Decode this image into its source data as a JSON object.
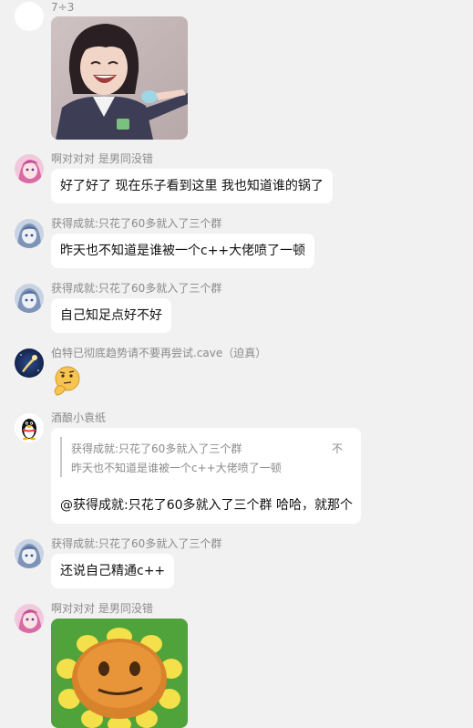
{
  "messages": [
    {
      "sender": "7÷3",
      "type": "image",
      "avatar": "white-circle-avatar",
      "image": "laughing-girl-pointing-photo"
    },
    {
      "sender": "啊对对对 是男同没错",
      "type": "text",
      "avatar": "pink-anime-girl-avatar",
      "text": "好了好了 现在乐子看到这里 我也知道谁的锅了"
    },
    {
      "sender": "获得成就:只花了60多就入了三个群",
      "type": "text",
      "avatar": "blue-anime-avatar",
      "text": "昨天也不知道是谁被一个c++大佬喷了一顿"
    },
    {
      "sender": "获得成就:只花了60多就入了三个群",
      "type": "text",
      "avatar": "blue-anime-avatar",
      "text": "自己知足点好不好"
    },
    {
      "sender": "伯特已彻底趋势请不要再尝试.cave（迫真）",
      "type": "sticker",
      "avatar": "comet-night-sky-avatar",
      "sticker": "thinking-emoji-sticker"
    },
    {
      "sender": "酒酿小袁纸",
      "type": "reply",
      "avatar": "qq-penguin-avatar",
      "quote": {
        "sender": "获得成就:只花了60多就入了三个群",
        "text": "昨天也不知道是谁被一个c++大佬喷了一顿",
        "tail": "不"
      },
      "text": "@获得成就:只花了60多就入了三个群  哈哈，就那个"
    },
    {
      "sender": "获得成就:只花了60多就入了三个群",
      "type": "text",
      "avatar": "blue-anime-avatar",
      "text": "还说自己精通c++"
    },
    {
      "sender": "啊对对对 是男同没错",
      "type": "image",
      "avatar": "pink-anime-girl-avatar",
      "image": "sunflower-face-sticker"
    }
  ],
  "colors": {
    "background": "#f1f1f1",
    "bubble": "#ffffff",
    "name": "#8b8b8b",
    "quote_bar": "#c8c8c8"
  }
}
